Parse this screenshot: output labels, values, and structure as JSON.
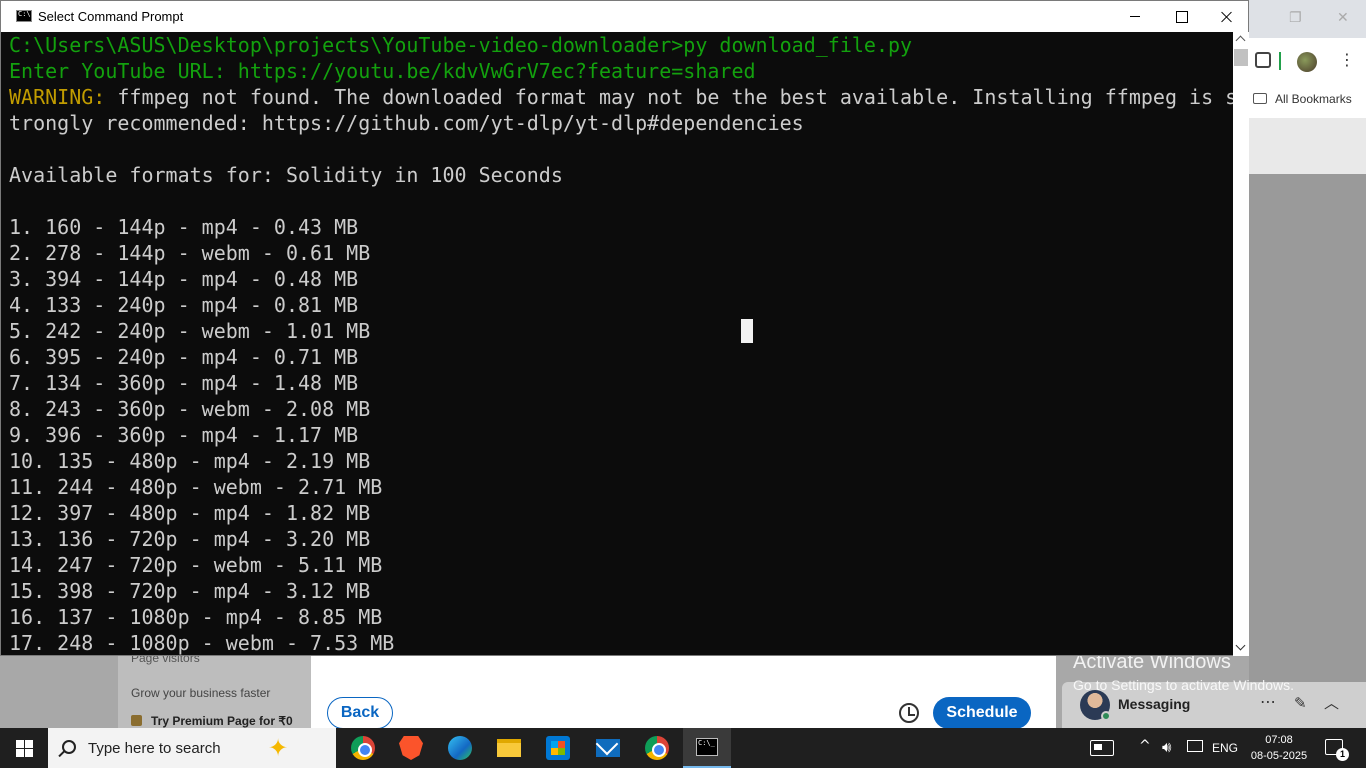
{
  "cmd": {
    "title": "Select Command Prompt",
    "lines": [
      "C:\\Users\\ASUS\\Desktop\\projects\\YouTube-video-downloader>py download_file.py",
      "Enter YouTube URL: https://youtu.be/kdvVwGrV7ec?feature=shared",
      "ffmpeg not found. The downloaded format may not be the best available. Installing ffmpeg is s",
      "trongly recommended: https://github.com/yt-dlp/yt-dlp#dependencies",
      "",
      "Available formats for: Solidity in 100 Seconds",
      "",
      "1. 160 - 144p - mp4 - 0.43 MB",
      "2. 278 - 144p - webm - 0.61 MB",
      "3. 394 - 144p - mp4 - 0.48 MB",
      "4. 133 - 240p - mp4 - 0.81 MB",
      "5. 242 - 240p - webm - 1.01 MB",
      "6. 395 - 240p - mp4 - 0.71 MB",
      "7. 134 - 360p - mp4 - 1.48 MB",
      "8. 243 - 360p - webm - 2.08 MB",
      "9. 396 - 360p - mp4 - 1.17 MB",
      "10. 135 - 480p - mp4 - 2.19 MB",
      "11. 244 - 480p - webm - 2.71 MB",
      "12. 397 - 480p - mp4 - 1.82 MB",
      "13. 136 - 720p - mp4 - 3.20 MB",
      "14. 247 - 720p - webm - 5.11 MB",
      "15. 398 - 720p - mp4 - 3.12 MB",
      "16. 137 - 1080p - mp4 - 8.85 MB",
      "17. 248 - 1080p - webm - 7.53 MB"
    ],
    "warning_prefix": "WARNING:",
    "colors": {
      "background": "#0c0c0c",
      "text": "#cccccc",
      "prompt": "#13a10e",
      "warning": "#c19c00"
    }
  },
  "browser": {
    "bookmarks_label": "All Bookmarks"
  },
  "page": {
    "left_card": {
      "page_visitors": "Page visitors",
      "grow": "Grow your business faster",
      "premium": "Try Premium Page for ₹0"
    },
    "modal": {
      "back_label": "Back",
      "schedule_label": "Schedule"
    },
    "messaging_label": "Messaging",
    "watermark": {
      "title": "Activate Windows",
      "subtitle": "Go to Settings to activate Windows."
    }
  },
  "taskbar": {
    "search_placeholder": "Type here to search",
    "language": "ENG",
    "time": "07:08",
    "date": "08-05-2025",
    "notification_count": "1",
    "pinned_icons": [
      "chrome-icon",
      "brave-icon",
      "edge-icon",
      "file-explorer-icon",
      "microsoft-store-icon",
      "mail-icon",
      "chrome-profile-icon",
      "command-prompt-icon"
    ]
  }
}
